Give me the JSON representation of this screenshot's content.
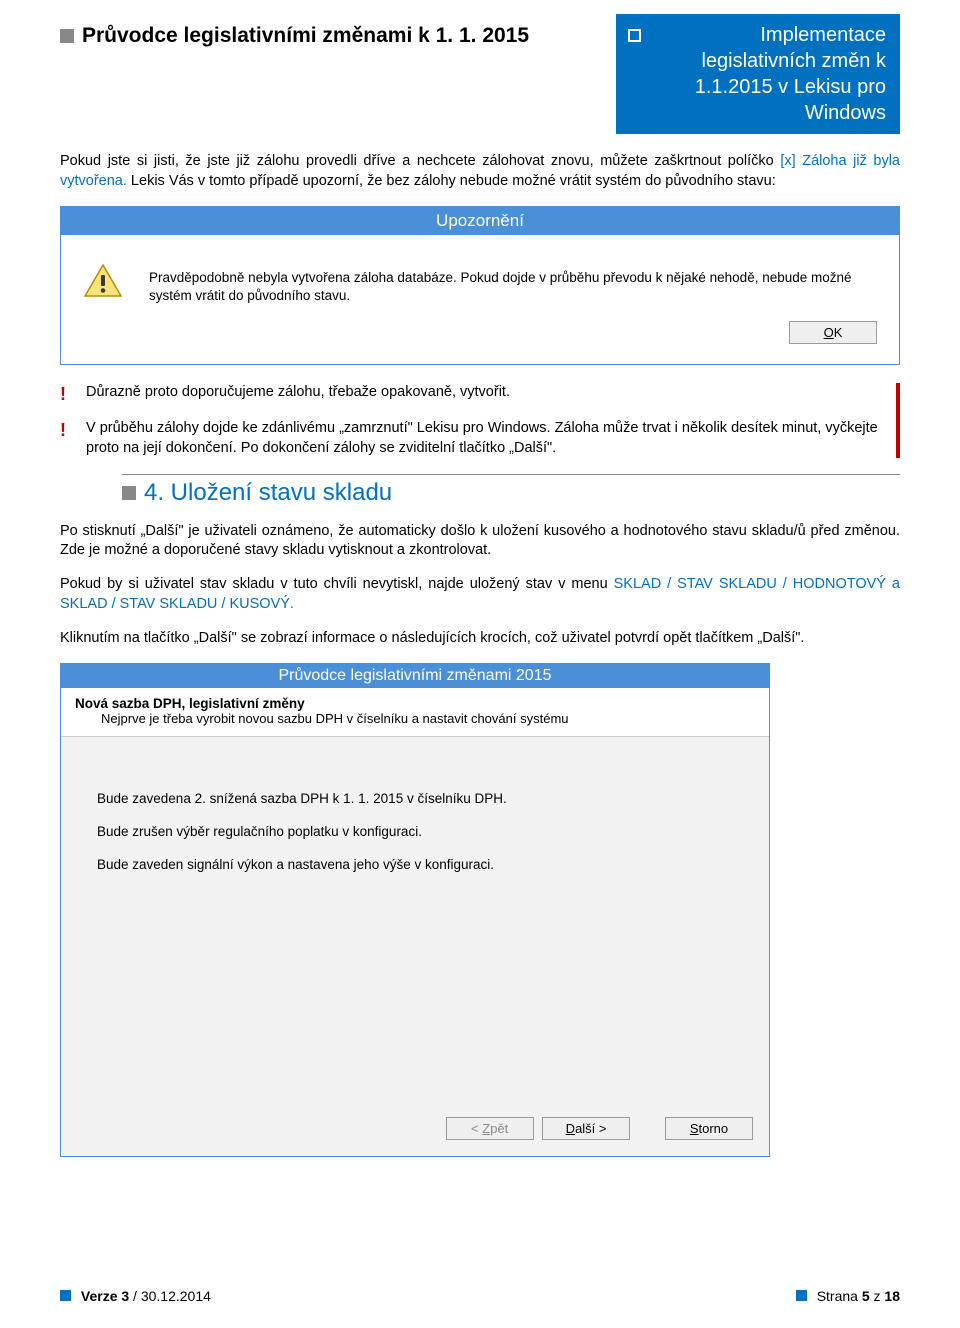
{
  "header": {
    "left_title": "Průvodce legislativními změnami k 1. 1. 2015",
    "right_title": "Implementace legislativních změn k 1.1.2015 v Lekisu pro Windows"
  },
  "intro": {
    "p1a": "Pokud jste si jisti, že jste již zálohu provedli dříve a nechcete zálohovat znovu, můžete zaškrtnout políčko ",
    "p1_blue": "[x] Záloha již byla vytvořena.",
    "p1b": " Lekis Vás v tomto případě upozorní, že bez zálohy nebude možné vrátit systém do původního stavu:"
  },
  "warning_dialog": {
    "title": "Upozornění",
    "message": "Pravděpodobně nebyla vytvořena záloha databáze. Pokud dojde v průběhu převodu k nějaké nehodě, nebude možné systém vrátit do původního stavu.",
    "ok_html": "<u>O</u>K"
  },
  "exclamations": {
    "e1": "Důrazně proto doporučujeme zálohu, třebaže opakovaně, vytvořit.",
    "e2": "V průběhu zálohy dojde ke zdánlivému „zamrznutí\" Lekisu pro Windows. Záloha může trvat i několik desítek minut, vyčkejte proto na její dokončení. Po dokončení zálohy se zviditelní tlačítko „Další\"."
  },
  "section4": {
    "heading": "4. Uložení stavu skladu",
    "p1": "Po stisknutí „Další\" je uživateli oznámeno, že automaticky došlo k uložení kusového a hodnotového stavu skladu/ů před změnou. Zde je možné a doporučené stavy skladu vytisknout a zkontrolovat.",
    "p2a": "Pokud by si uživatel stav skladu v tuto chvíli nevytiskl, najde uložený stav v menu ",
    "p2_blue": "SKLAD / STAV SKLADU / HODNOTOVÝ a SKLAD / STAV SKLADU / KUSOVÝ.",
    "p3": "Kliknutím na tlačítko „Další\" se zobrazí informace o následujících krocích, což uživatel potvrdí opět tlačítkem „Další\"."
  },
  "wizard": {
    "title": "Průvodce legislativními změnami 2015",
    "head_bold": "Nová sazba DPH, legislativní změny",
    "head_sub": "Nejprve je třeba vyrobit novou sazbu DPH v číselníku a nastavit chování systému",
    "body_lines": [
      "Bude zavedena 2. snížená sazba DPH k 1. 1. 2015 v číselníku DPH.",
      "Bude zrušen výběr regulačního poplatku v konfiguraci.",
      "Bude zaveden signální výkon a nastavena jeho výše v konfiguraci."
    ],
    "btn_back_html": "< <u>Z</u>pět",
    "btn_next_html": "<u>D</u>alší >",
    "btn_cancel_html": "<u>S</u>torno"
  },
  "footer": {
    "left_html": "<b>Verze 3</b> / 30.12.2014",
    "right_html": "Strana <b>5</b> z <b>18</b>"
  }
}
